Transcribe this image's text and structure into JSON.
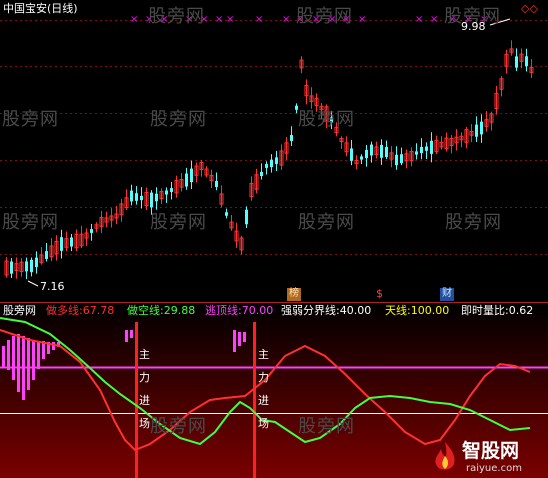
{
  "colors": {
    "background": "#000000",
    "up_candle": "#ff3232",
    "down_candle": "#54ffff",
    "watermark": "#4a4a4a",
    "xmark": "#ff00ff",
    "bull_line": "#ff3030",
    "bear_line": "#40ff40",
    "top_line": "#ff40ff",
    "zone_line": "#ffffff",
    "entry_bar": "#ff2020",
    "label_white": "#ffffff",
    "label_yellow": "#ffff00"
  },
  "main_chart": {
    "title": "中国宝安(日线)",
    "high_label": "9.98",
    "low_label": "7.16",
    "top_right_marker": "◇◇",
    "tags": [
      "榜",
      "$",
      "财"
    ],
    "tag_colors": [
      "#ffb060",
      "#ff4040",
      "#60a0ff"
    ]
  },
  "watermarks": [
    "股旁网",
    "股旁网",
    "股旁网",
    "股旁网",
    "股旁网",
    "股旁网",
    "股旁网",
    "股旁网",
    "股旁网",
    "股旁网",
    "股旁网",
    "股旁网"
  ],
  "indicator": {
    "name": "股旁网",
    "items": [
      {
        "label": "做多线:",
        "value": "67.78",
        "color": "#ff3030"
      },
      {
        "label": "做空线:",
        "value": "29.88",
        "color": "#40ff40"
      },
      {
        "label": "逃顶线:",
        "value": "70.00",
        "color": "#ff40ff"
      },
      {
        "label": "强弱分界线:",
        "value": "40.00",
        "color": "#ffffff"
      },
      {
        "label": "天线:",
        "value": "100.00",
        "color": "#ffff00"
      },
      {
        "label": "即时量比:",
        "value": "0.62",
        "color": "#ffffff"
      }
    ],
    "entry_signal_chars": [
      "主",
      "力",
      "进",
      "场"
    ]
  },
  "logo": {
    "text": "智股网",
    "url_text": "raiyue.com"
  }
}
